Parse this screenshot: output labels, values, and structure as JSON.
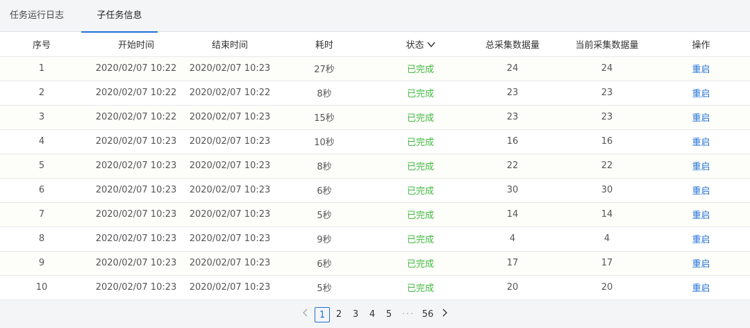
{
  "tabs": [
    {
      "label": "任务运行日志",
      "active": false
    },
    {
      "label": "子任务信息",
      "active": true
    }
  ],
  "table": {
    "columns": [
      "序号",
      "开始时间",
      "结束时间",
      "耗时",
      "状态",
      "总采集数据量",
      "当前采集数据量",
      "操作"
    ],
    "rows": [
      [
        "1",
        "2020/02/07 10:22",
        "2020/02/07 10:23",
        "27秒",
        "已完成",
        "24",
        "24",
        "重启"
      ],
      [
        "2",
        "2020/02/07 10:22",
        "2020/02/07 10:22",
        "8秒",
        "已完成",
        "23",
        "23",
        "重启"
      ],
      [
        "3",
        "2020/02/07 10:22",
        "2020/02/07 10:23",
        "15秒",
        "已完成",
        "23",
        "23",
        "重启"
      ],
      [
        "4",
        "2020/02/07 10:23",
        "2020/02/07 10:23",
        "10秒",
        "已完成",
        "16",
        "16",
        "重启"
      ],
      [
        "5",
        "2020/02/07 10:23",
        "2020/02/07 10:23",
        "8秒",
        "已完成",
        "22",
        "22",
        "重启"
      ],
      [
        "6",
        "2020/02/07 10:23",
        "2020/02/07 10:23",
        "6秒",
        "已完成",
        "30",
        "30",
        "重启"
      ],
      [
        "7",
        "2020/02/07 10:23",
        "2020/02/07 10:23",
        "5秒",
        "已完成",
        "14",
        "14",
        "重启"
      ],
      [
        "8",
        "2020/02/07 10:23",
        "2020/02/07 10:23",
        "9秒",
        "已完成",
        "4",
        "4",
        "重启"
      ],
      [
        "9",
        "2020/02/07 10:23",
        "2020/02/07 10:23",
        "6秒",
        "已完成",
        "17",
        "17",
        "重启"
      ],
      [
        "10",
        "2020/02/07 10:23",
        "2020/02/07 10:23",
        "5秒",
        "已完成",
        "20",
        "20",
        "重启"
      ]
    ]
  },
  "pagination": {
    "prev_icon": "chevron-left-icon",
    "next_icon": "chevron-right-icon",
    "pages": [
      "1",
      "2",
      "3",
      "4",
      "5"
    ],
    "current": "1",
    "ellipsis": "···",
    "last": "56"
  },
  "colors": {
    "accent": "#1f6fd6",
    "status_done": "#3fb93f"
  }
}
